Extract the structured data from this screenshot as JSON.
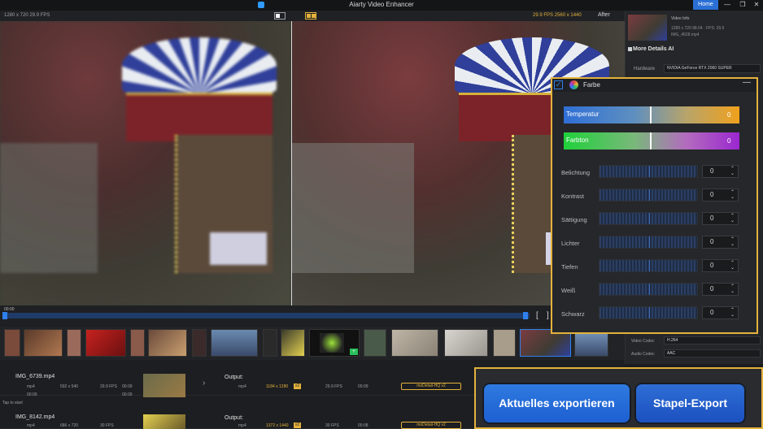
{
  "app": {
    "title": "Aiarty Video Enhancer",
    "home_label": "Home"
  },
  "window": {
    "minimize": "—",
    "restore": "❐",
    "close": "✕"
  },
  "preview": {
    "before_info": "1280 x 720  29.9 FPS",
    "after_info": "29.9 FPS  2560 x 1440",
    "after_label": "After"
  },
  "timeline": {
    "time": "00:00",
    "bracket_left": "[",
    "bracket_right": "]"
  },
  "tasks": [
    {
      "name": "IMG_6739.mp4",
      "fmt": "mp4",
      "res": "592 x 540",
      "fps": "29.9 FPS",
      "dur": "00:09",
      "out_label": "Output:",
      "out_fmt": "mp4",
      "out_res": "1184 x 1280",
      "out_scale": "x2",
      "out_fps": "29.9 FPS",
      "out_dur": "00:09",
      "model": "moDetail-HQ  v2",
      "t0": "00:00",
      "t1": "00:09"
    },
    {
      "name": "IMG_8142.mp4",
      "fmt": "mp4",
      "res": "686 x 720",
      "fps": "30 FPS",
      "out_label": "Output:",
      "out_fmt": "mp4",
      "out_res": "1372 x 1440",
      "out_scale": "x2",
      "out_fps": "30 FPS",
      "out_dur": "00:08",
      "model": "moDetail-HQ  v2"
    }
  ],
  "tasks_hint": "Tap to start",
  "right_panel": {
    "video_info_title": "Video Info",
    "video_info_line1": "1280 x 720  98.04 · FPS: 29.9",
    "video_info_line2": "IMG_4628.mp4",
    "more_details": "More Details AI",
    "hardware_label": "Hardware",
    "hardware_value": "NVIDIA GeForce RTX 2060 SUPER",
    "video_codec_label": "Video Codec",
    "video_codec_value": "H.264",
    "audio_codec_label": "Audio Codec",
    "audio_codec_value": "AAC"
  },
  "farbe": {
    "title": "Farbe",
    "check": "✓",
    "minimize": "—",
    "temperature": {
      "label": "Temperatur",
      "value": "0"
    },
    "hue": {
      "label": "Farbton",
      "value": "0"
    },
    "adjustments": [
      {
        "label": "Belichtung",
        "value": "0"
      },
      {
        "label": "Kontrast",
        "value": "0"
      },
      {
        "label": "Sättigung",
        "value": "0"
      },
      {
        "label": "Lichter",
        "value": "0"
      },
      {
        "label": "Tiefen",
        "value": "0"
      },
      {
        "label": "Weiß",
        "value": "0"
      },
      {
        "label": "Schwarz",
        "value": "0"
      }
    ]
  },
  "export": {
    "export_label": "Aktuelles exportieren",
    "batch_label": "Stapel-Export"
  },
  "colors": {
    "accent": "#2f80ed",
    "highlight": "#e3b23c"
  }
}
